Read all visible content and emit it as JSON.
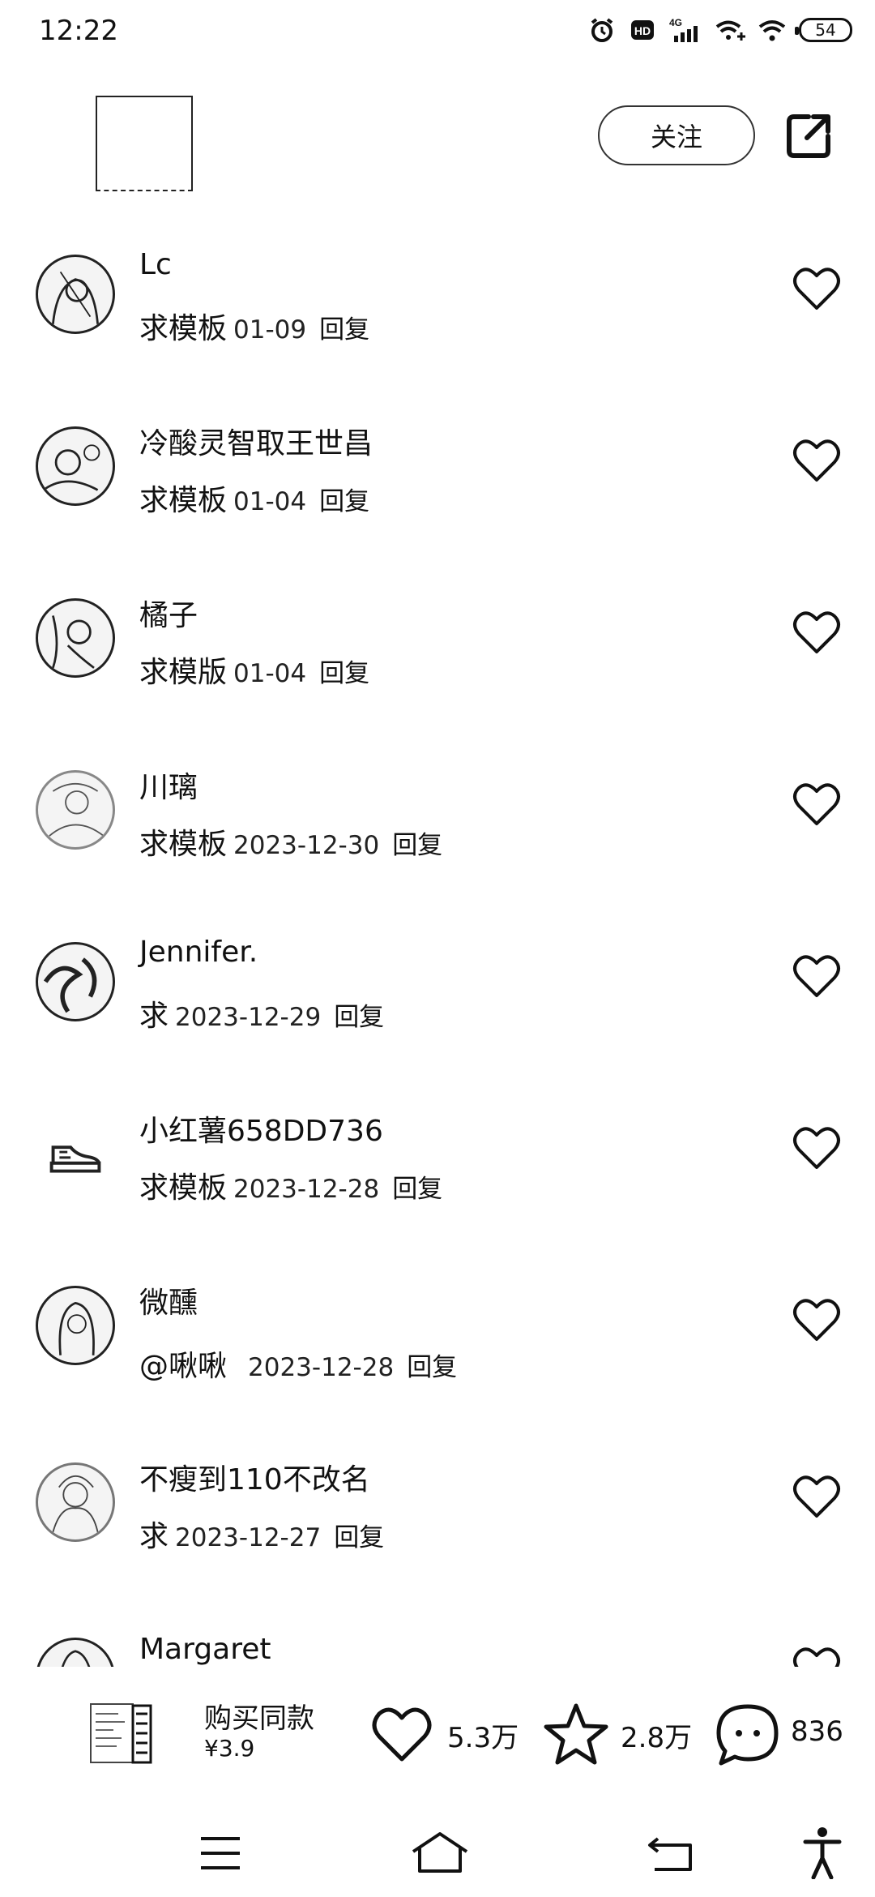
{
  "status_bar": {
    "time": "12:22",
    "network": "4G",
    "battery": "54",
    "icons": [
      "alarm-icon",
      "hd-icon",
      "signal-icon",
      "wifi-plus-icon",
      "wifi-icon",
      "battery-icon"
    ]
  },
  "header": {
    "follow_label": "关注",
    "share_icon": "share-external-icon"
  },
  "comments": [
    {
      "user": "Lc",
      "text": "求模板",
      "date": "01-09",
      "reply": "回复"
    },
    {
      "user": "冷酸灵智取王世昌",
      "text": "求模板",
      "date": "01-04",
      "reply": "回复"
    },
    {
      "user": "橘子",
      "text": "求模版",
      "date": "01-04",
      "reply": "回复"
    },
    {
      "user": "川璃",
      "text": "求模板",
      "date": "2023-12-30",
      "reply": "回复"
    },
    {
      "user": "Jennifer.",
      "text": "求",
      "date": "2023-12-29",
      "reply": "回复"
    },
    {
      "user": "小红薯658DD736",
      "text": "求模板",
      "date": "2023-12-28",
      "reply": "回复"
    },
    {
      "user": "微醺",
      "text": "@啾啾",
      "date": "2023-12-28",
      "reply": "回复"
    },
    {
      "user": "不瘦到110不改名",
      "text": "求",
      "date": "2023-12-27",
      "reply": "回复"
    },
    {
      "user": "Margaret",
      "text": "",
      "date": "",
      "reply": ""
    }
  ],
  "bottom_bar": {
    "buy_title": "购买同款",
    "buy_price": "¥3.9",
    "likes": "5.3万",
    "favorites": "2.8万",
    "comments": "836"
  },
  "nav_bar": {
    "icons": [
      "menu-icon",
      "home-icon",
      "back-icon",
      "accessibility-icon"
    ]
  }
}
